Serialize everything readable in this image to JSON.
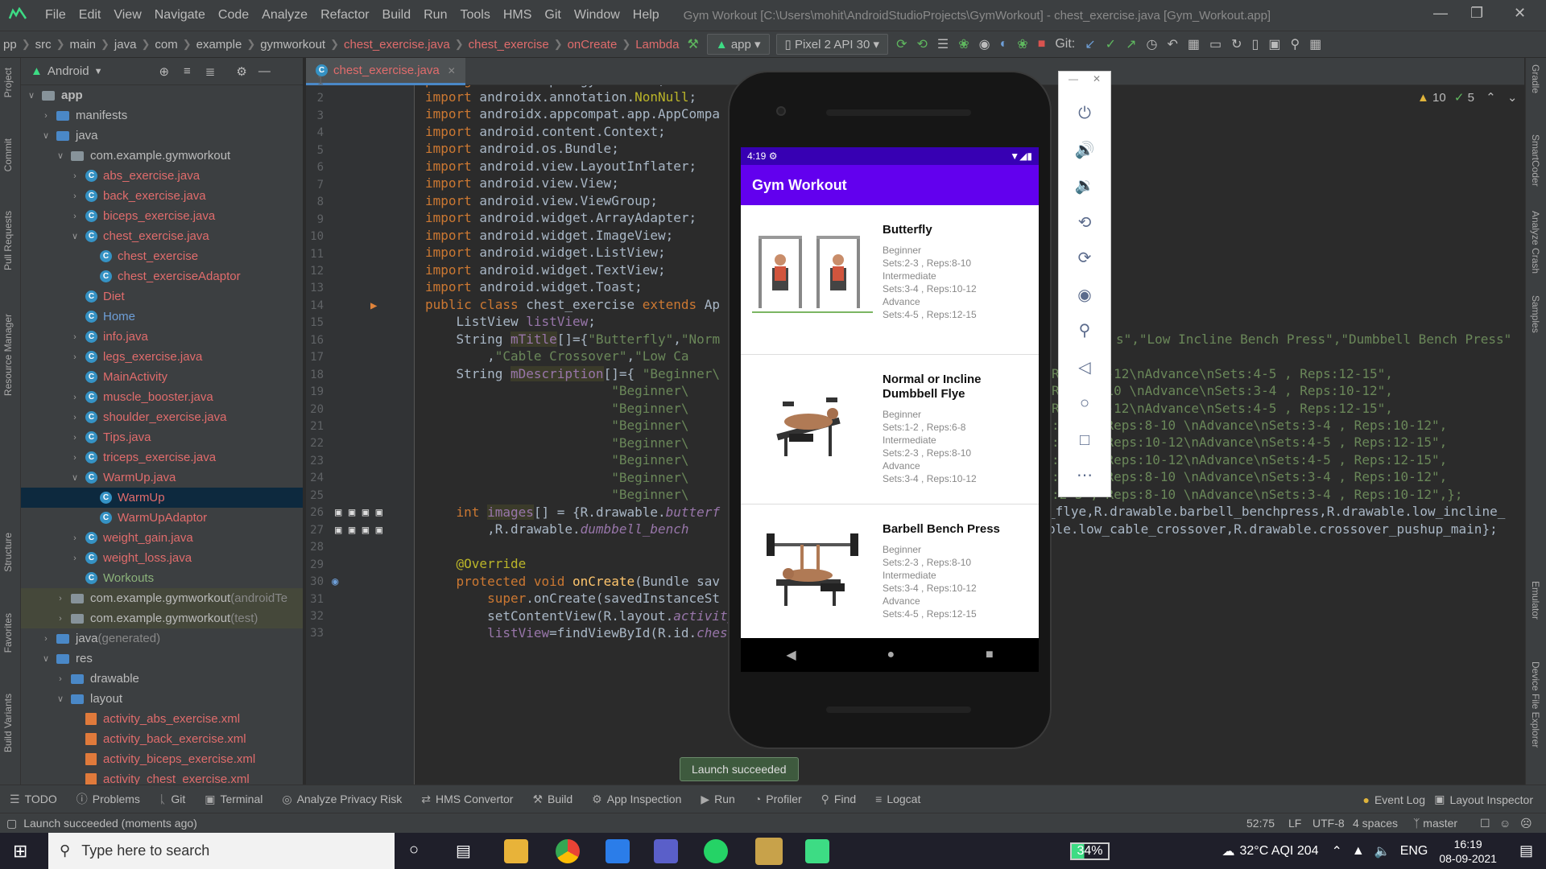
{
  "window": {
    "title": "Gym Workout [C:\\Users\\mohit\\AndroidStudioProjects\\GymWorkout] - chest_exercise.java [Gym_Workout.app]"
  },
  "menu": [
    "File",
    "Edit",
    "View",
    "Navigate",
    "Code",
    "Analyze",
    "Refactor",
    "Build",
    "Run",
    "Tools",
    "HMS",
    "Git",
    "Window",
    "Help"
  ],
  "breadcrumbs": [
    "pp",
    "src",
    "main",
    "java",
    "com",
    "example",
    "gymworkout",
    "chest_exercise.java",
    "chest_exercise",
    "onCreate",
    "Lambda"
  ],
  "toolbar": {
    "run_config": "app",
    "device": "Pixel 2 API 30",
    "git_label": "Git:"
  },
  "left_tabs": [
    "Project",
    "Commit",
    "Pull Requests",
    "Resource Manager",
    "Structure",
    "Favorites",
    "Build Variants"
  ],
  "right_tabs": [
    "Gradle",
    "SmartCoder",
    "Analyze Crash",
    "Samples",
    "Emulator",
    "Device File Explorer"
  ],
  "project": {
    "view_label": "Android",
    "tree": [
      {
        "label": "app",
        "type": "root",
        "indent": 0,
        "chev": "v"
      },
      {
        "label": "manifests",
        "type": "folder",
        "indent": 1,
        "chev": ">"
      },
      {
        "label": "java",
        "type": "folder",
        "indent": 1,
        "chev": "v"
      },
      {
        "label": "com.example.gymworkout",
        "type": "pkg",
        "indent": 2,
        "chev": "v"
      },
      {
        "label": "abs_exercise.java",
        "type": "class-red",
        "indent": 3,
        "chev": ">"
      },
      {
        "label": "back_exercise.java",
        "type": "class-red",
        "indent": 3,
        "chev": ">"
      },
      {
        "label": "biceps_exercise.java",
        "type": "class-red",
        "indent": 3,
        "chev": ">"
      },
      {
        "label": "chest_exercise.java",
        "type": "class-red",
        "indent": 3,
        "chev": "v"
      },
      {
        "label": "chest_exercise",
        "type": "class-red",
        "indent": 4,
        "chev": ""
      },
      {
        "label": "chest_exerciseAdaptor",
        "type": "class-red",
        "indent": 4,
        "chev": ""
      },
      {
        "label": "Diet",
        "type": "class-red",
        "indent": 3,
        "chev": ""
      },
      {
        "label": "Home",
        "type": "class-blue",
        "indent": 3,
        "chev": ""
      },
      {
        "label": "info.java",
        "type": "class-red",
        "indent": 3,
        "chev": ">"
      },
      {
        "label": "legs_exercise.java",
        "type": "class-red",
        "indent": 3,
        "chev": ">"
      },
      {
        "label": "MainActivity",
        "type": "class-red",
        "indent": 3,
        "chev": ""
      },
      {
        "label": "muscle_booster.java",
        "type": "class-red",
        "indent": 3,
        "chev": ">"
      },
      {
        "label": "shoulder_exercise.java",
        "type": "class-red",
        "indent": 3,
        "chev": ">"
      },
      {
        "label": "Tips.java",
        "type": "class-red",
        "indent": 3,
        "chev": ">"
      },
      {
        "label": "triceps_exercise.java",
        "type": "class-red",
        "indent": 3,
        "chev": ">"
      },
      {
        "label": "WarmUp.java",
        "type": "class-red",
        "indent": 3,
        "chev": "v"
      },
      {
        "label": "WarmUp",
        "type": "class-red",
        "indent": 4,
        "chev": "",
        "selected": true
      },
      {
        "label": "WarmUpAdaptor",
        "type": "class-red",
        "indent": 4,
        "chev": ""
      },
      {
        "label": "weight_gain.java",
        "type": "class-red",
        "indent": 3,
        "chev": ">"
      },
      {
        "label": "weight_loss.java",
        "type": "class-red",
        "indent": 3,
        "chev": ">"
      },
      {
        "label": "Workouts",
        "type": "class-green",
        "indent": 3,
        "chev": ""
      },
      {
        "label": "com.example.gymworkout",
        "suffix": " (androidTe",
        "type": "pkg-mod",
        "indent": 2,
        "chev": ">"
      },
      {
        "label": "com.example.gymworkout",
        "suffix": " (test)",
        "type": "pkg-mod",
        "indent": 2,
        "chev": ">"
      },
      {
        "label": "java",
        "suffix": " (generated)",
        "type": "folder",
        "indent": 1,
        "chev": ">"
      },
      {
        "label": "res",
        "type": "folder",
        "indent": 1,
        "chev": "v"
      },
      {
        "label": "drawable",
        "type": "folder",
        "indent": 2,
        "chev": ">"
      },
      {
        "label": "layout",
        "type": "folder",
        "indent": 2,
        "chev": "v"
      },
      {
        "label": "activity_abs_exercise.xml",
        "type": "xml",
        "indent": 3,
        "chev": ""
      },
      {
        "label": "activity_back_exercise.xml",
        "type": "xml",
        "indent": 3,
        "chev": ""
      },
      {
        "label": "activity_biceps_exercise.xml",
        "type": "xml",
        "indent": 3,
        "chev": ""
      },
      {
        "label": "activity_chest_exercise.xml",
        "type": "xml",
        "indent": 3,
        "chev": ""
      }
    ]
  },
  "editor": {
    "tab": "chest_exercise.java",
    "inspections": {
      "warnings": "10",
      "weak": "5"
    },
    "line_numbers": [
      "1",
      "2",
      "3",
      "4",
      "5",
      "6",
      "7",
      "8",
      "9",
      "10",
      "11",
      "12",
      "13",
      "14",
      "15",
      "16",
      "17",
      "18",
      "19",
      "20",
      "21",
      "22",
      "23",
      "24",
      "25",
      "26",
      "27",
      "28",
      "29",
      "30",
      "31",
      "32",
      "33"
    ],
    "right_code": [
      {
        "line": 16,
        "text": "s\",\"Low Incline Bench Press\",\"Dumbbell Bench Press\""
      },
      {
        "line": 18,
        "text": "Reps:10-12\\nAdvance\\nSets:4-5 , Reps:12-15\","
      },
      {
        "line": 19,
        "text": "Reps:8-10 \\nAdvance\\nSets:3-4 , Reps:10-12\","
      },
      {
        "line": 20,
        "text": "Reps:10-12\\nAdvance\\nSets:4-5 , Reps:12-15\","
      },
      {
        "line": 21,
        "text": ":2-3 , Reps:8-10 \\nAdvance\\nSets:3-4 , Reps:10-12\","
      },
      {
        "line": 22,
        "text": ":3-4 , Reps:10-12\\nAdvance\\nSets:4-5 , Reps:12-15\","
      },
      {
        "line": 23,
        "text": ":3-4 , Reps:10-12\\nAdvance\\nSets:4-5 , Reps:12-15\","
      },
      {
        "line": 24,
        "text": ":2-3 , Reps:8-10 \\nAdvance\\nSets:3-4 , Reps:10-12\","
      },
      {
        "line": 25,
        "text": ":2-3 , Reps:8-10 \\nAdvance\\nSets:3-4 , Reps:10-12\",};"
      },
      {
        "line": 26,
        "text": "_flye,R.drawable.barbell_benchpress,R.drawable.low_incline_"
      },
      {
        "line": 27,
        "text": "ble.low_cable_crossover,R.drawable.crossover_pushup_main};"
      }
    ]
  },
  "phone": {
    "time": "4:19",
    "app_title": "Gym Workout",
    "cards": [
      {
        "title": "Butterfly",
        "desc": "Beginner\nSets:2-3 , Reps:8-10\nIntermediate\nSets:3-4 , Reps:10-12\nAdvance\nSets:4-5 , Reps:12-15"
      },
      {
        "title": "Normal or Incline Dumbbell Flye",
        "desc": "Beginner\nSets:1-2 , Reps:6-8\nIntermediate\nSets:2-3 , Reps:8-10\nAdvance\nSets:3-4 , Reps:10-12"
      },
      {
        "title": "Barbell Bench Press",
        "desc": "Beginner\nSets:2-3 , Reps:8-10\nIntermediate\nSets:3-4 , Reps:10-12\nAdvance\nSets:4-5 , Reps:12-15"
      }
    ]
  },
  "toast": "Launch succeeded",
  "bottom_tools": [
    "TODO",
    "Problems",
    "Git",
    "Terminal",
    "Analyze Privacy Risk",
    "HMS Convertor",
    "Build",
    "App Inspection",
    "Run",
    "Profiler",
    "Find",
    "Logcat"
  ],
  "bottom_right_tools": [
    "Event Log",
    "Layout Inspector"
  ],
  "status": {
    "message": "Launch succeeded (moments ago)",
    "position": "52:75",
    "line_sep": "LF",
    "encoding": "UTF-8",
    "indent": "4 spaces",
    "branch": "master"
  },
  "taskbar": {
    "search_placeholder": "Type here to search",
    "battery": "34%",
    "weather": "32°C AQI 204",
    "lang": "ENG",
    "time": "16:19",
    "date": "08-09-2021"
  }
}
